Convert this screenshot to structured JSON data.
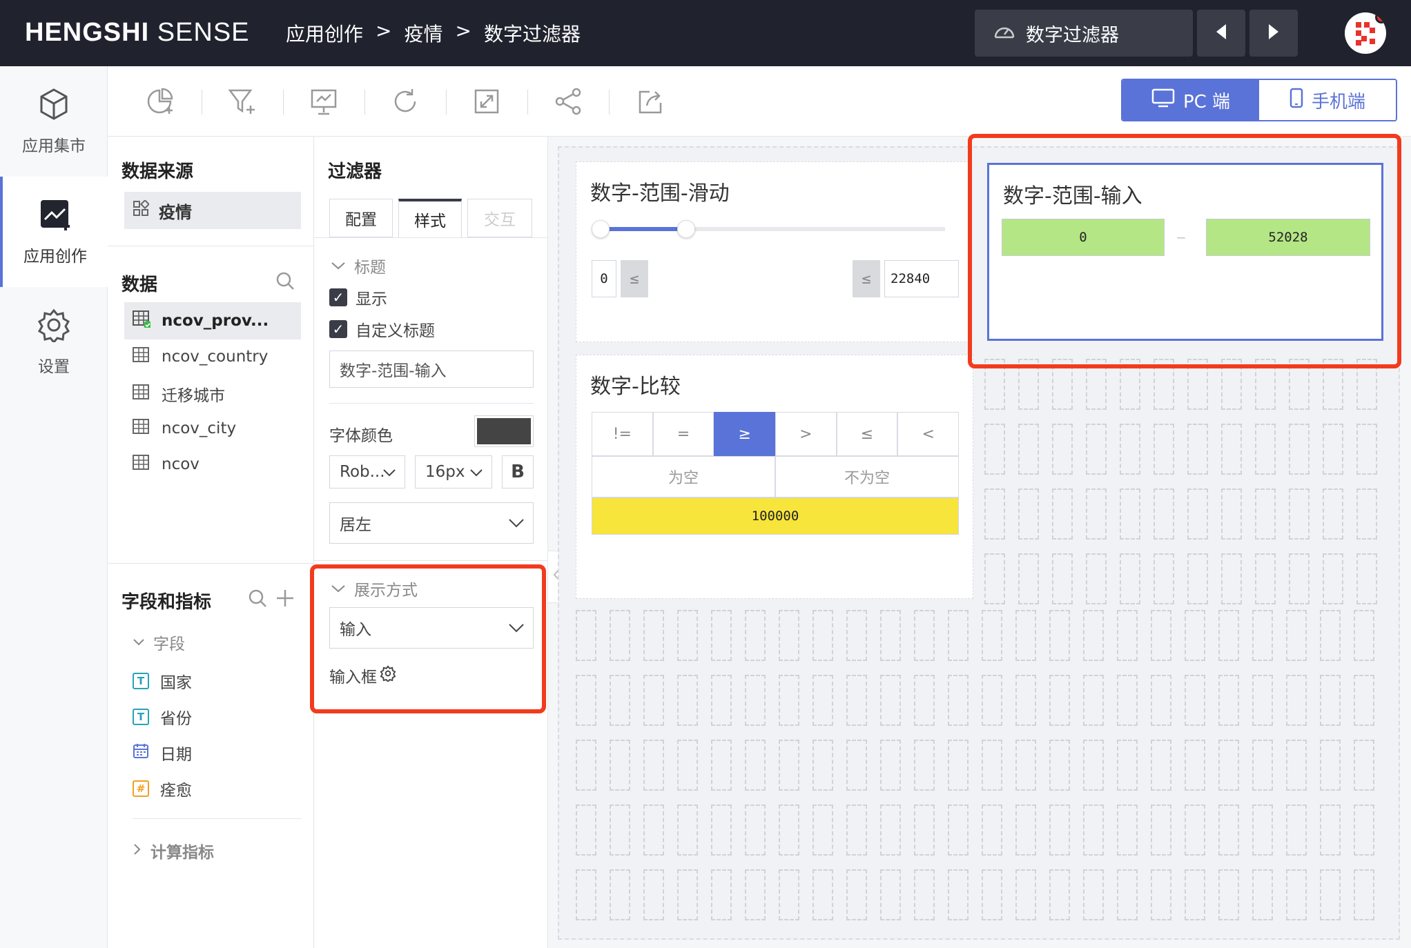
{
  "app": {
    "logo_main": "HENGSHI",
    "logo_sub": " SENSE"
  },
  "breadcrumb": {
    "c1": "应用创作",
    "sep1": ">",
    "c2": "疫情",
    "sep2": ">",
    "c3": "数字过滤器"
  },
  "dashboard_selector": {
    "label": "数字过滤器"
  },
  "leftnav": {
    "market": "应用集市",
    "create": "应用创作",
    "settings": "设置"
  },
  "device": {
    "pc": "PC 端",
    "mobile": "手机端"
  },
  "panel_data": {
    "source_heading": "数据来源",
    "source_name": "疫情",
    "data_heading": "数据",
    "datasets": [
      "ncov_prov...",
      "ncov_country",
      "迁移城市",
      "ncov_city",
      "ncov"
    ],
    "fields_heading": "字段和指标",
    "fields_group": "字段",
    "fields": [
      {
        "type": "T",
        "name": "国家"
      },
      {
        "type": "T",
        "name": "省份"
      },
      {
        "type": "date",
        "name": "日期"
      },
      {
        "type": "#",
        "name": "痊愈"
      }
    ],
    "calc_group": "计算指标"
  },
  "panel_filter": {
    "heading": "过滤器",
    "tabs": [
      "配置",
      "样式",
      "交互"
    ],
    "title_section": "标题",
    "show_label": "显示",
    "custom_title_label": "自定义标题",
    "custom_title_value": "数字-范围-输入",
    "font_color_label": "字体颜色",
    "font_color": "#444444",
    "font_family": "Rob...",
    "font_size": "16px",
    "bold": "B",
    "align": "居左",
    "display_section": "展示方式",
    "display_value": "输入",
    "input_box_label": "输入框"
  },
  "canvas": {
    "slider_card": {
      "title": "数字-范围-滑动",
      "min_value": "0",
      "max_value": "22840",
      "le_symbol": "≤",
      "fill": 0.25
    },
    "compare_card": {
      "title": "数字-比较",
      "ops": [
        "!=",
        "=",
        "≥",
        ">",
        "≤",
        "<"
      ],
      "active_op": "≥",
      "empty": "为空",
      "not_empty": "不为空",
      "value": "100000"
    },
    "input_card": {
      "title": "数字-范围-输入",
      "min": "0",
      "dash": "—",
      "max": "52028"
    }
  },
  "colors": {
    "accent": "#5a73d8",
    "highlight": "#f23b1d",
    "green": "#b5e685",
    "yellow": "#f7e53b"
  }
}
